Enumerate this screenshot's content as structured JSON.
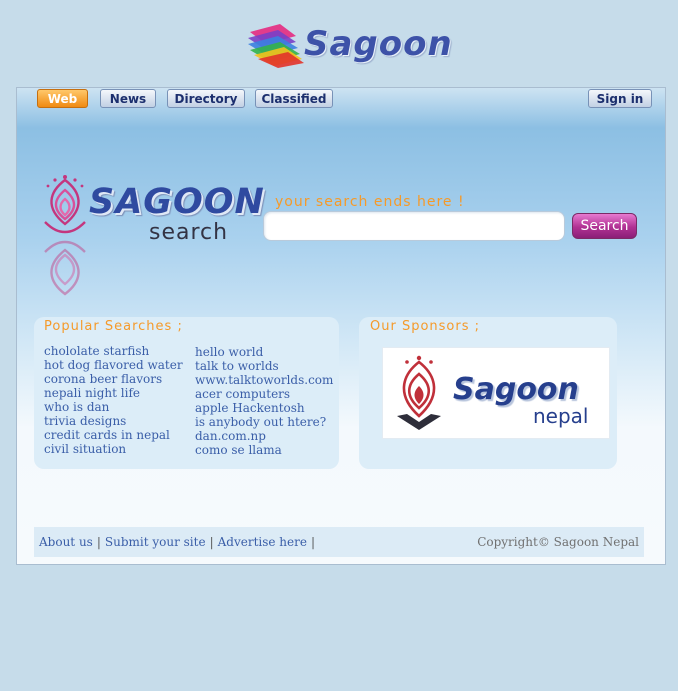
{
  "brand": {
    "name": "Sagoon"
  },
  "tabs": [
    {
      "label": "Web",
      "active": true
    },
    {
      "label": "News",
      "active": false
    },
    {
      "label": "Directory",
      "active": false
    },
    {
      "label": "Classified",
      "active": false
    }
  ],
  "signin_label": "Sign in",
  "search": {
    "logo_word1": "SAGOON",
    "logo_word2": "search",
    "tagline": "your search ends here !",
    "value": "",
    "button_label": "Search"
  },
  "popular": {
    "title": "Popular Searches ;",
    "left": [
      "chololate starfish",
      "hot dog flavored water",
      "corona beer flavors",
      "nepali night life",
      "who is dan",
      "trivia designs",
      "credit cards in nepal",
      "civil situation"
    ],
    "right": [
      "hello world",
      "talk to worlds",
      "www.talktoworlds.com",
      "acer computers",
      "apple Hackentosh",
      "is anybody out htere?",
      "dan.com.np",
      "como se llama"
    ]
  },
  "sponsors": {
    "title": "Our Sponsors ;",
    "banner_word1": "Sagoon",
    "banner_word2": "nepal"
  },
  "footer": {
    "links": [
      "About us",
      "Submit your site",
      "Advertise here"
    ],
    "separator": "|",
    "copyright": "Copyright© Sagoon Nepal"
  },
  "colors": {
    "accent_orange": "#f59a2a",
    "brand_blue": "#3d52a8",
    "search_button": "#b03193",
    "link_blue": "#3a5ea8"
  }
}
